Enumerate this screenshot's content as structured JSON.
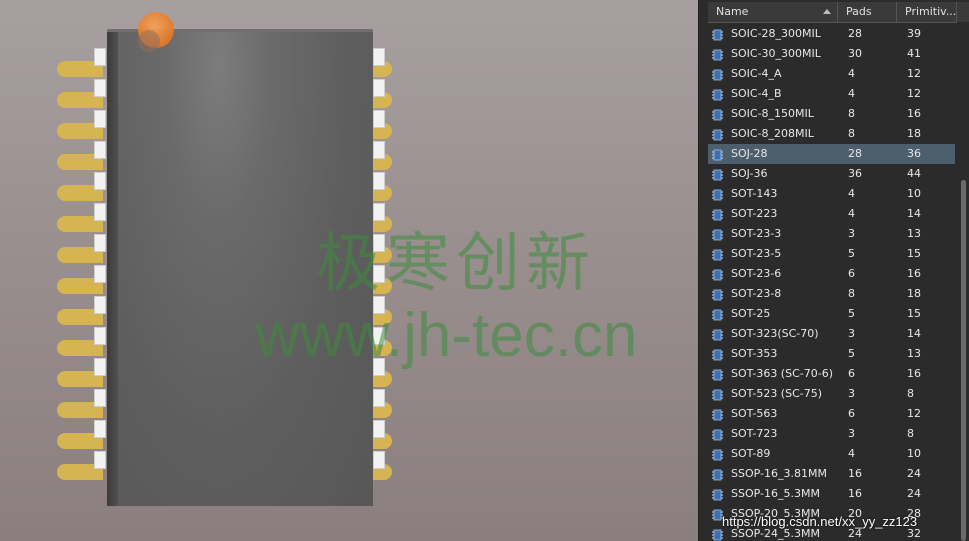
{
  "viewport": {
    "watermark_cn": "极寒创新",
    "watermark_url": "www.jh-tec.cn"
  },
  "panel": {
    "columns": {
      "name": "Name",
      "pads": "Pads",
      "primitives": "Primitiv..."
    },
    "rows": [
      {
        "name": "SOIC-28_300MIL",
        "pads": "28",
        "primitives": "39"
      },
      {
        "name": "SOIC-30_300MIL",
        "pads": "30",
        "primitives": "41"
      },
      {
        "name": "SOIC-4_A",
        "pads": "4",
        "primitives": "12"
      },
      {
        "name": "SOIC-4_B",
        "pads": "4",
        "primitives": "12"
      },
      {
        "name": "SOIC-8_150MIL",
        "pads": "8",
        "primitives": "16"
      },
      {
        "name": "SOIC-8_208MIL",
        "pads": "8",
        "primitives": "18"
      },
      {
        "name": "SOJ-28",
        "pads": "28",
        "primitives": "36",
        "selected": true
      },
      {
        "name": "SOJ-36",
        "pads": "36",
        "primitives": "44"
      },
      {
        "name": "SOT-143",
        "pads": "4",
        "primitives": "10"
      },
      {
        "name": "SOT-223",
        "pads": "4",
        "primitives": "14"
      },
      {
        "name": "SOT-23-3",
        "pads": "3",
        "primitives": "13"
      },
      {
        "name": "SOT-23-5",
        "pads": "5",
        "primitives": "15"
      },
      {
        "name": "SOT-23-6",
        "pads": "6",
        "primitives": "16"
      },
      {
        "name": "SOT-23-8",
        "pads": "8",
        "primitives": "18"
      },
      {
        "name": "SOT-25",
        "pads": "5",
        "primitives": "15"
      },
      {
        "name": "SOT-323(SC-70)",
        "pads": "3",
        "primitives": "14"
      },
      {
        "name": "SOT-353",
        "pads": "5",
        "primitives": "13"
      },
      {
        "name": "SOT-363 (SC-70-6)",
        "pads": "6",
        "primitives": "16"
      },
      {
        "name": "SOT-523 (SC-75)",
        "pads": "3",
        "primitives": "8"
      },
      {
        "name": "SOT-563",
        "pads": "6",
        "primitives": "12"
      },
      {
        "name": "SOT-723",
        "pads": "3",
        "primitives": "8"
      },
      {
        "name": "SOT-89",
        "pads": "4",
        "primitives": "10"
      },
      {
        "name": "SSOP-16_3.81MM",
        "pads": "16",
        "primitives": "24"
      },
      {
        "name": "SSOP-16_5.3MM",
        "pads": "16",
        "primitives": "24"
      },
      {
        "name": "SSOP-20_5.3MM",
        "pads": "20",
        "primitives": "28"
      },
      {
        "name": "SSOP-24_5.3MM",
        "pads": "24",
        "primitives": "32"
      }
    ]
  },
  "url_watermark": "https://blog.csdn.net/xx_yy_zz123",
  "colors": {
    "selected_row": "#4d5e6d",
    "pad_gold": "#d6b452",
    "pin1_marker": "#e87d2a"
  }
}
